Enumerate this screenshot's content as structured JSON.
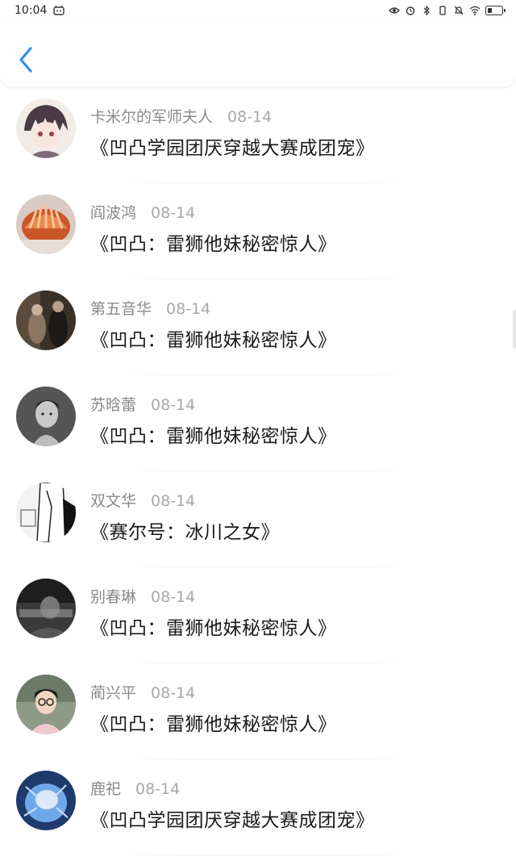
{
  "status": {
    "time": "10:04"
  },
  "colors": {
    "accent": "#2f8fe6"
  },
  "items": [
    {
      "name": "卡米尔的军师夫人",
      "date": "08-14",
      "title": "《凹凸学园团厌穿越大赛成团宠》"
    },
    {
      "name": "阎波鸿",
      "date": "08-14",
      "title": "《凹凸：雷狮他妹秘密惊人》"
    },
    {
      "name": "第五音华",
      "date": "08-14",
      "title": "《凹凸：雷狮他妹秘密惊人》"
    },
    {
      "name": "苏晗蕾",
      "date": "08-14",
      "title": "《凹凸：雷狮他妹秘密惊人》"
    },
    {
      "name": "双文华",
      "date": "08-14",
      "title": "《赛尔号：冰川之女》"
    },
    {
      "name": "别春琳",
      "date": "08-14",
      "title": "《凹凸：雷狮他妹秘密惊人》"
    },
    {
      "name": "蔺兴平",
      "date": "08-14",
      "title": "《凹凸：雷狮他妹秘密惊人》"
    },
    {
      "name": "鹿祀",
      "date": "08-14",
      "title": "《凹凸学园团厌穿越大赛成团宠》"
    }
  ]
}
